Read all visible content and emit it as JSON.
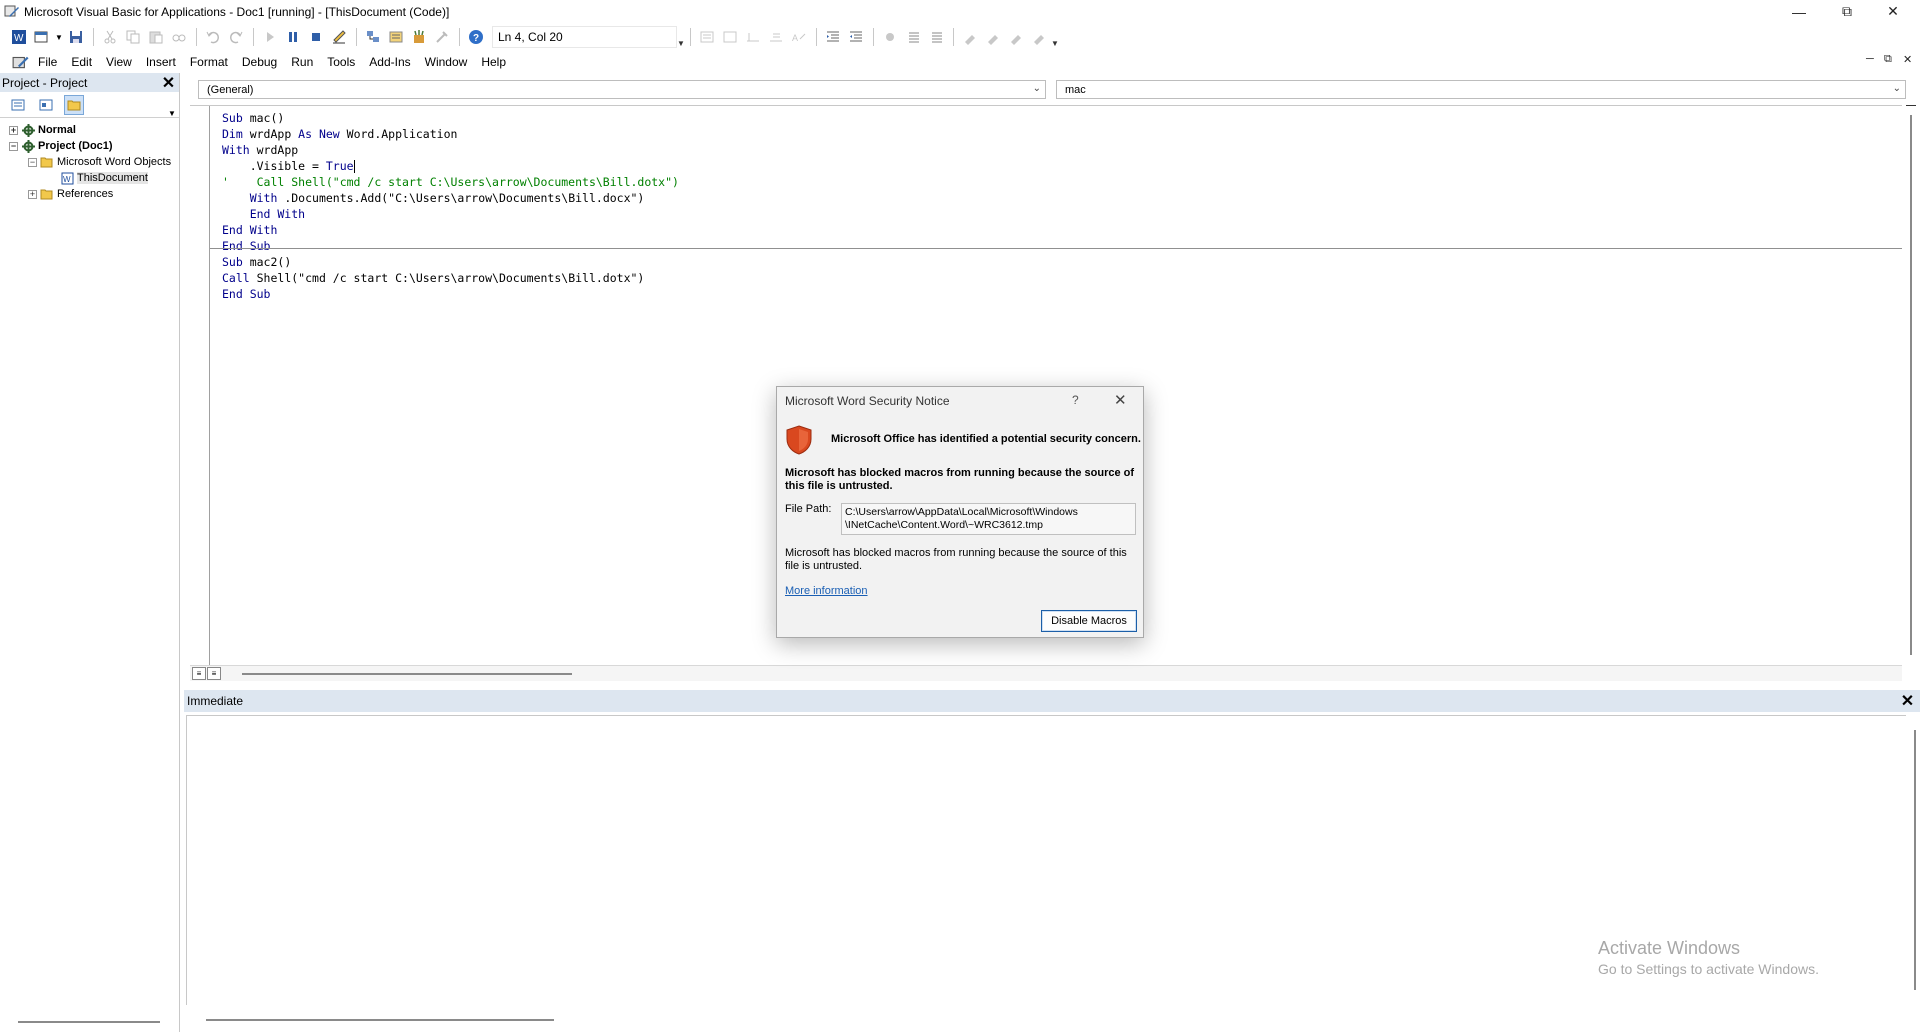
{
  "window": {
    "title": "Microsoft Visual Basic for Applications - Doc1 [running] - [ThisDocument (Code)]"
  },
  "toolbar": {
    "position_text": "Ln 4, Col 20"
  },
  "menu": {
    "items": [
      "File",
      "Edit",
      "View",
      "Insert",
      "Format",
      "Debug",
      "Run",
      "Tools",
      "Add-Ins",
      "Window",
      "Help"
    ]
  },
  "project_pane": {
    "title": "Project - Project",
    "tree": [
      {
        "label": "Normal"
      },
      {
        "label": "Project (Doc1)"
      },
      {
        "label": "Microsoft Word Objects"
      },
      {
        "label": "ThisDocument"
      },
      {
        "label": "References"
      }
    ]
  },
  "code_window": {
    "object_combo": "(General)",
    "proc_combo": "mac"
  },
  "code_lines": [
    "Sub mac()",
    "Dim wrdApp As New Word.Application",
    "With wrdApp",
    "    .Visible = True",
    "'    Call Shell(\"cmd /c start C:\\Users\\arrow\\Documents\\Bill.dotx\")",
    "    With .Documents.Add(\"C:\\Users\\arrow\\Documents\\Bill.docx\")",
    "    End With",
    "End With",
    "End Sub",
    "Sub mac2()",
    "Call Shell(\"cmd /c start C:\\Users\\arrow\\Documents\\Bill.dotx\")",
    "End Sub"
  ],
  "immediate": {
    "title": "Immediate"
  },
  "watermark": {
    "line1": "Activate Windows",
    "line2": "Go to Settings to activate Windows."
  },
  "dialog": {
    "title": "Microsoft Word Security Notice",
    "help": "?",
    "heading": "Microsoft Office has identified a potential security concern.",
    "blocked_bold": "Microsoft has blocked macros from running because the source of this file is untrusted.",
    "file_path_label": "File Path:",
    "file_path_line1": "C:\\Users\\arrow\\AppData\\Local\\Microsoft\\Windows",
    "file_path_line2": "\\INetCache\\Content.Word\\~WRC3612.tmp",
    "blocked": "Microsoft has blocked macros from running because the source of this file is untrusted.",
    "more_info": "More information",
    "button": "Disable Macros"
  },
  "colors": {
    "keyword": "#00008b",
    "comment": "#008000",
    "pane_header": "#dde6f0",
    "shield": "#d9481f"
  }
}
